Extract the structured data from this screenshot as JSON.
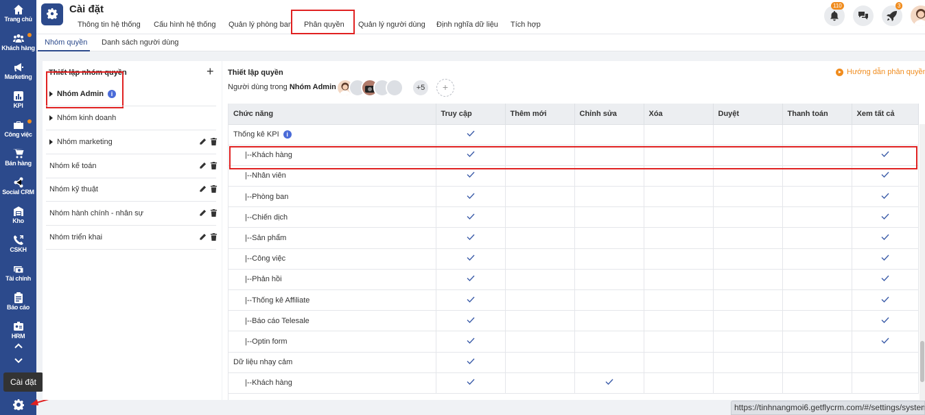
{
  "sidebar": {
    "items": [
      {
        "label": "Trang chủ",
        "icon": "home-icon"
      },
      {
        "label": "Khách hàng",
        "icon": "users-icon",
        "dot": true
      },
      {
        "label": "Marketing",
        "icon": "megaphone-icon"
      },
      {
        "label": "KPI",
        "icon": "chart-icon"
      },
      {
        "label": "Công việc",
        "icon": "briefcase-icon",
        "dot": true
      },
      {
        "label": "Bán hàng",
        "icon": "cart-icon"
      },
      {
        "label": "Social CRM",
        "icon": "share-icon"
      },
      {
        "label": "Kho",
        "icon": "warehouse-icon"
      },
      {
        "label": "CSKH",
        "icon": "phone-icon"
      },
      {
        "label": "Tài chính",
        "icon": "money-icon"
      },
      {
        "label": "Báo cáo",
        "icon": "clipboard-icon"
      },
      {
        "label": "HRM",
        "icon": "id-card-icon"
      }
    ],
    "tooltip": "Cài đặt"
  },
  "header": {
    "title": "Cài đặt",
    "tabs": [
      {
        "label": "Thông tin hệ thống"
      },
      {
        "label": "Cấu hình hệ thống"
      },
      {
        "label": "Quản lý phòng ban"
      },
      {
        "label": "Phân quyền"
      },
      {
        "label": "Quản lý người dùng"
      },
      {
        "label": "Định nghĩa dữ liệu"
      },
      {
        "label": "Tích hợp"
      }
    ],
    "active_tab": "Phân quyền",
    "notification_count": "110",
    "rocket_count": "3"
  },
  "subtabs": [
    {
      "label": "Nhóm quyền"
    },
    {
      "label": "Danh sách người dùng"
    }
  ],
  "left_panel": {
    "title": "Thiết lập nhóm quyền",
    "groups": [
      {
        "name": "Nhóm Admin"
      },
      {
        "name": "Nhóm kinh doanh"
      },
      {
        "name": "Nhóm marketing"
      },
      {
        "name": "Nhóm kế toán"
      },
      {
        "name": "Nhóm kỹ thuật"
      },
      {
        "name": "Nhóm hành chính - nhân sự"
      },
      {
        "name": "Nhóm triển khai"
      }
    ]
  },
  "right_panel": {
    "title": "Thiết lập quyền",
    "users_label": "Người dùng trong",
    "group_name": "Nhóm Admin:",
    "more_users": "+5",
    "add_user": "+",
    "guide_link": "Hướng dẫn phân quyền",
    "columns": [
      "Chức năng",
      "Truy cập",
      "Thêm mới",
      "Chỉnh sửa",
      "Xóa",
      "Duyệt",
      "Thanh toán",
      "Xem tất cả"
    ],
    "rows": [
      {
        "name": "Thống kê KPI",
        "checks": [
          true,
          false,
          false,
          false,
          false,
          false,
          false
        ],
        "info": true,
        "sub": false
      },
      {
        "name": "|--Khách hàng",
        "checks": [
          true,
          false,
          false,
          false,
          false,
          false,
          true
        ],
        "sub": true
      },
      {
        "name": "|--Nhân viên",
        "checks": [
          true,
          false,
          false,
          false,
          false,
          false,
          true
        ],
        "sub": true
      },
      {
        "name": "|--Phòng ban",
        "checks": [
          true,
          false,
          false,
          false,
          false,
          false,
          true
        ],
        "sub": true
      },
      {
        "name": "|--Chiến dịch",
        "checks": [
          true,
          false,
          false,
          false,
          false,
          false,
          true
        ],
        "sub": true
      },
      {
        "name": "|--Sản phẩm",
        "checks": [
          true,
          false,
          false,
          false,
          false,
          false,
          true
        ],
        "sub": true
      },
      {
        "name": "|--Công việc",
        "checks": [
          true,
          false,
          false,
          false,
          false,
          false,
          true
        ],
        "sub": true
      },
      {
        "name": "|--Phản hồi",
        "checks": [
          true,
          false,
          false,
          false,
          false,
          false,
          true
        ],
        "sub": true
      },
      {
        "name": "|--Thống kê Affiliate",
        "checks": [
          true,
          false,
          false,
          false,
          false,
          false,
          true
        ],
        "sub": true
      },
      {
        "name": "|--Báo cáo Telesale",
        "checks": [
          true,
          false,
          false,
          false,
          false,
          false,
          true
        ],
        "sub": true
      },
      {
        "name": "|--Optin form",
        "checks": [
          true,
          false,
          false,
          false,
          false,
          false,
          true
        ],
        "sub": true
      },
      {
        "name": "Dữ liệu nhạy cảm",
        "checks": [
          true,
          false,
          false,
          false,
          false,
          false,
          false
        ],
        "sub": false
      },
      {
        "name": "|--Khách hàng",
        "checks": [
          true,
          false,
          true,
          false,
          false,
          false,
          false
        ],
        "sub": true
      }
    ]
  },
  "statusbar": {
    "url": "https://tinhnangmoi6.getflycrm.com/#/settings/system"
  },
  "colors": {
    "sidebar": "#2c4a8c",
    "accent": "#f08c1e",
    "highlight": "#e02020",
    "check": "#3a5ba8"
  }
}
